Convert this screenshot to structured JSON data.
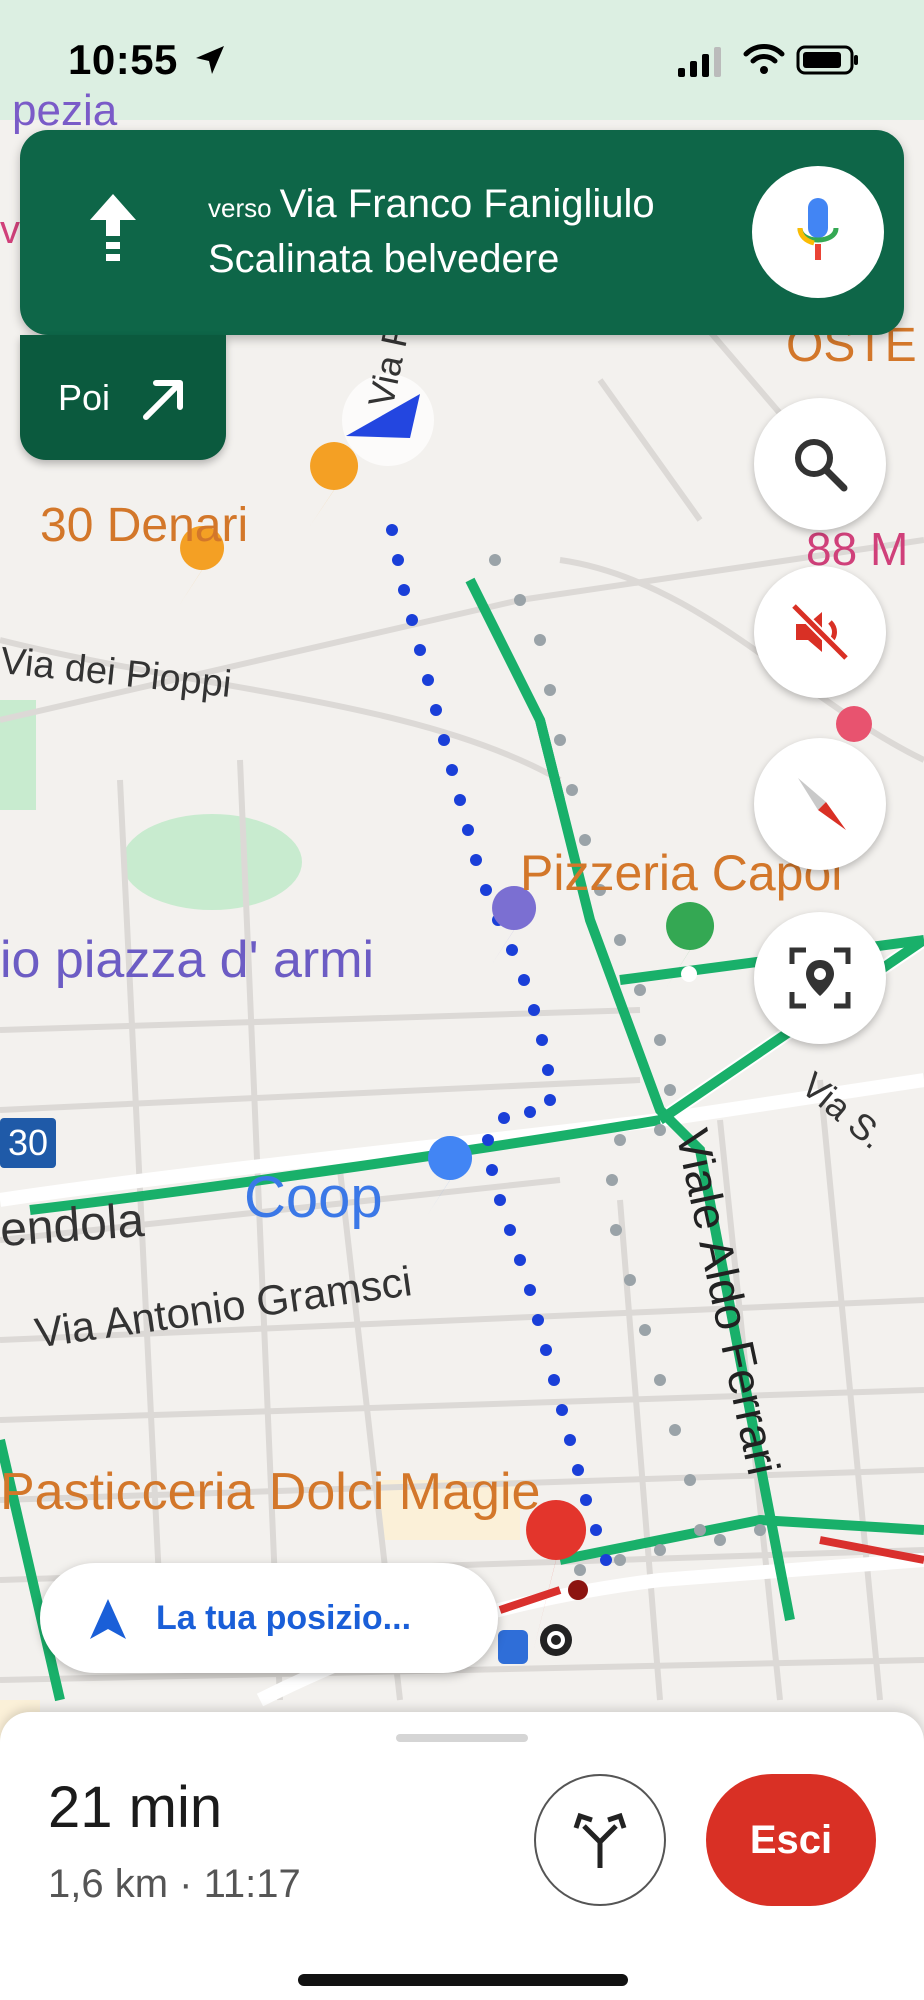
{
  "status_bar": {
    "time": "10:55"
  },
  "navigation": {
    "direction_icon": "straight-arrow-icon",
    "toward_prefix": "verso",
    "street": "Via Franco Fanigliulo",
    "secondary": "Scalinata belvedere",
    "then_label": "Poi",
    "then_icon": "turn-right-icon"
  },
  "map": {
    "labels": {
      "top_partial": "pezia",
      "left_partial_v": "ve",
      "oste": "OSTE",
      "denari": "30 Denari",
      "via_pioppi": "Via dei Pioppi",
      "num88": "88 M",
      "pizzeria": "Pizzeria Capol",
      "piazza": "io piazza d' armi",
      "via_s": "Via S.",
      "route_num": "30",
      "endola": "endola",
      "coop": "Coop",
      "gramsci": "Via Antonio Gramsci",
      "viale_aldo": "Viale Aldo Ferrari",
      "via_fr": "Via Fr",
      "pasticceria": "Pasticceria Dolci Magie"
    }
  },
  "location_pill": {
    "label": "La tua posizio..."
  },
  "trip": {
    "duration": "21 min",
    "details": "1,6 km · 11:17",
    "exit_label": "Esci"
  },
  "colors": {
    "nav_green": "#0e6648",
    "route_blue": "#1a3fd8",
    "exit_red": "#d93025",
    "label_orange": "#d3772a"
  }
}
